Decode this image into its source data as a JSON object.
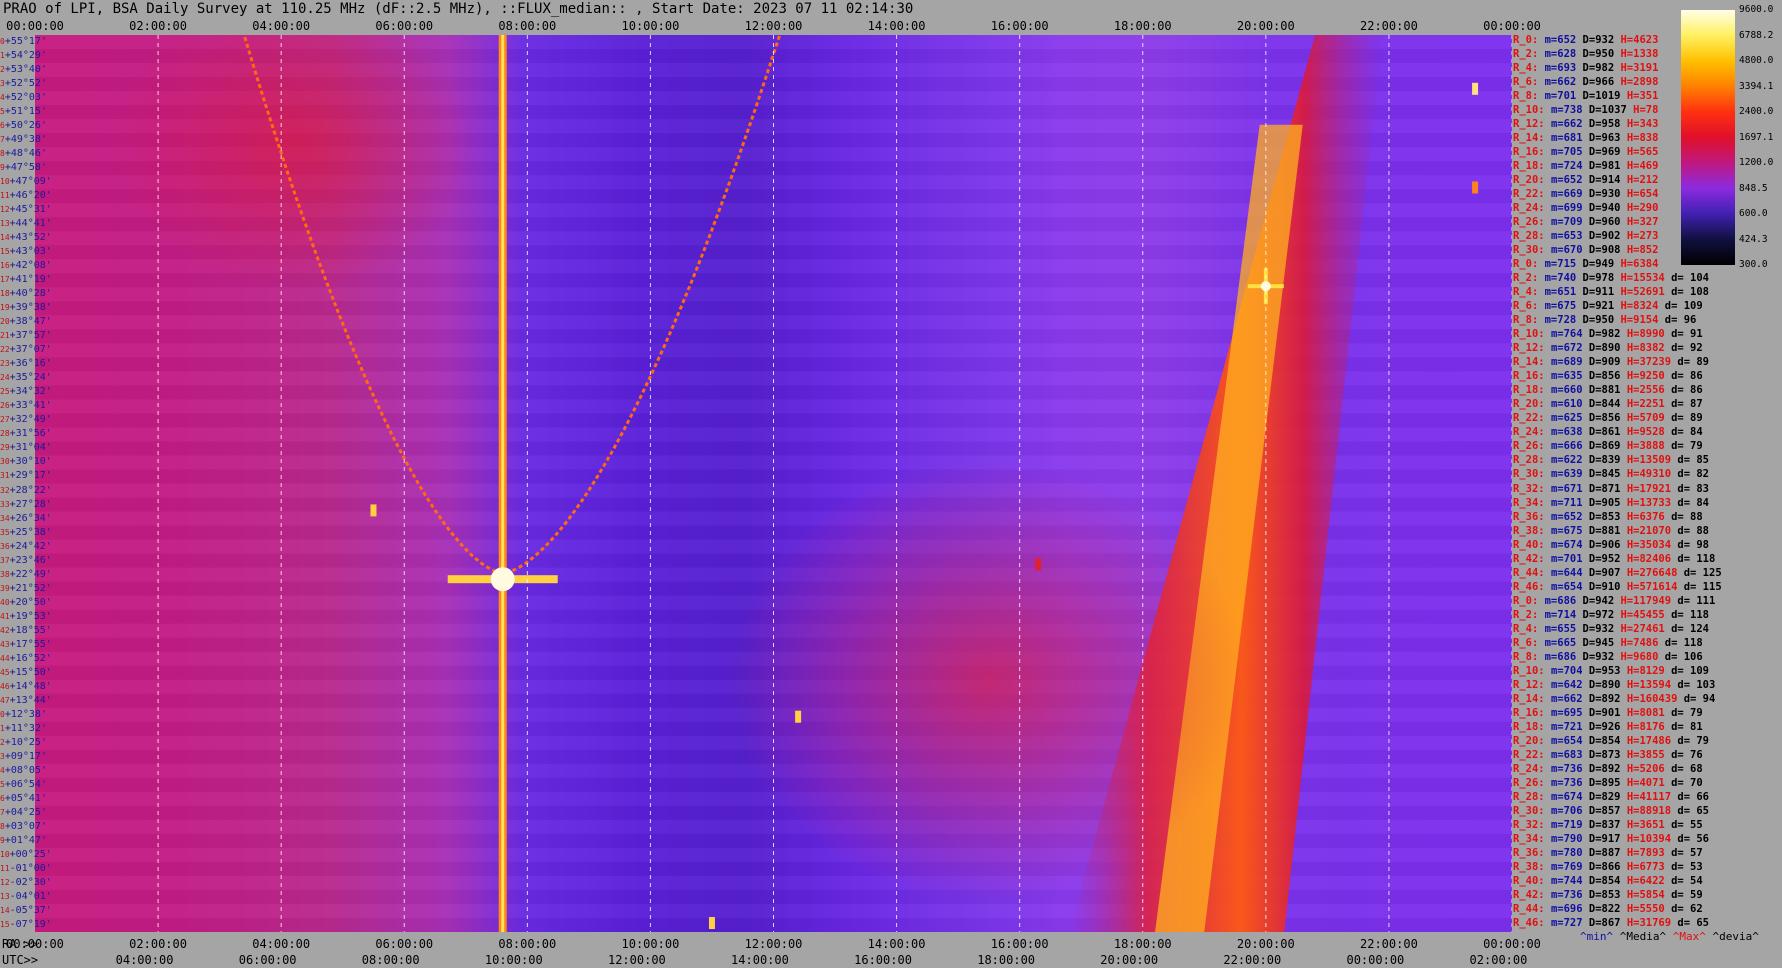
{
  "header": {
    "title": "PRAO of LPI, BSA Daily Survey at 110.25 MHz (dF::2.5 MHz), ::FLUX_median:: , Start Date: 2023 07 11 02:14:30"
  },
  "axes": {
    "top_ticks": [
      "00:00:00",
      "02:00:00",
      "04:00:00",
      "06:00:00",
      "08:00:00",
      "10:00:00",
      "12:00:00",
      "14:00:00",
      "16:00:00",
      "18:00:00",
      "20:00:00",
      "22:00:00",
      "00:00:00"
    ],
    "ra_tag": "RA >>",
    "ra_ticks": [
      "00:00:00",
      "02:00:00",
      "04:00:00",
      "06:00:00",
      "08:00:00",
      "10:00:00",
      "12:00:00",
      "14:00:00",
      "16:00:00",
      "18:00:00",
      "20:00:00",
      "22:00:00",
      "00:00:00"
    ],
    "utc_tag": "UTC>>",
    "utc_ticks": [
      "04:00:00",
      "06:00:00",
      "08:00:00",
      "10:00:00",
      "12:00:00",
      "14:00:00",
      "16:00:00",
      "18:00:00",
      "20:00:00",
      "22:00:00",
      "00:00:00",
      "02:00:00"
    ],
    "declinations": [
      "+55°17'",
      "+54°29'",
      "+53°40'",
      "+52°52'",
      "+52°03'",
      "+51°15'",
      "+50°26'",
      "+49°38'",
      "+48°46'",
      "+47°58'",
      "+47°09'",
      "+46°20'",
      "+45°31'",
      "+44°41'",
      "+43°52'",
      "+43°03'",
      "+42°08'",
      "+41°19'",
      "+40°28'",
      "+39°38'",
      "+38°47'",
      "+37°57'",
      "+37°07'",
      "+36°16'",
      "+35°24'",
      "+34°32'",
      "+33°41'",
      "+32°49'",
      "+31°56'",
      "+31°04'",
      "+30°10'",
      "+29°17'",
      "+28°22'",
      "+27°28'",
      "+26°34'",
      "+25°38'",
      "+24°42'",
      "+23°46'",
      "+22°49'",
      "+21°52'",
      "+20°50'",
      "+19°53'",
      "+18°55'",
      "+17°55'",
      "+16°52'",
      "+15°50'",
      "+14°48'",
      "+13°44'",
      "+12°38'",
      "+11°32'",
      "+10°25'",
      "+09°17'",
      "+08°05'",
      "+06°54'",
      "+05°41'",
      "+04°25'",
      "+03°07'",
      "+01°47'",
      "+00°25'",
      "-01°00'",
      "-02°30'",
      "-04°01'",
      "-05°37'",
      "-07°19'"
    ]
  },
  "colorbar": {
    "labels": [
      "9600.0",
      "6788.2",
      "4800.0",
      "3394.1",
      "2400.0",
      "1697.1",
      "1200.0",
      "848.5",
      "600.0",
      "424.3",
      "300.0"
    ],
    "colors": [
      "#ffffe8",
      "#fff060",
      "#ffc000",
      "#ff8000",
      "#ff3010",
      "#e0102a",
      "#c01880",
      "#8a2be0",
      "#4020b0",
      "#101040",
      "#000000"
    ]
  },
  "ray_stats": [
    {
      "r": "R_0:",
      "m": "m=652",
      "D": "D=932",
      "H": "H=4623",
      "d": ""
    },
    {
      "r": "R_2:",
      "m": "m=628",
      "D": "D=950",
      "H": "H=1338",
      "d": ""
    },
    {
      "r": "R_4:",
      "m": "m=693",
      "D": "D=982",
      "H": "H=3191",
      "d": ""
    },
    {
      "r": "R_6:",
      "m": "m=662",
      "D": "D=966",
      "H": "H=2898",
      "d": ""
    },
    {
      "r": "R_8:",
      "m": "m=701",
      "D": "D=1019",
      "H": "H=351",
      "d": ""
    },
    {
      "r": "R_10:",
      "m": "m=738",
      "D": "D=1037",
      "H": "H=78",
      "d": ""
    },
    {
      "r": "R_12:",
      "m": "m=662",
      "D": "D=958",
      "H": "H=343",
      "d": ""
    },
    {
      "r": "R_14:",
      "m": "m=681",
      "D": "D=963",
      "H": "H=838",
      "d": ""
    },
    {
      "r": "R_16:",
      "m": "m=705",
      "D": "D=969",
      "H": "H=565",
      "d": ""
    },
    {
      "r": "R_18:",
      "m": "m=724",
      "D": "D=981",
      "H": "H=469",
      "d": ""
    },
    {
      "r": "R_20:",
      "m": "m=652",
      "D": "D=914",
      "H": "H=212",
      "d": ""
    },
    {
      "r": "R_22:",
      "m": "m=669",
      "D": "D=930",
      "H": "H=654",
      "d": ""
    },
    {
      "r": "R_24:",
      "m": "m=699",
      "D": "D=940",
      "H": "H=290",
      "d": ""
    },
    {
      "r": "R_26:",
      "m": "m=709",
      "D": "D=960",
      "H": "H=327",
      "d": ""
    },
    {
      "r": "R_28:",
      "m": "m=653",
      "D": "D=902",
      "H": "H=273",
      "d": ""
    },
    {
      "r": "R_30:",
      "m": "m=670",
      "D": "D=908",
      "H": "H=852",
      "d": ""
    },
    {
      "r": "R_0:",
      "m": "m=715",
      "D": "D=949",
      "H": "H=6384",
      "d": ""
    },
    {
      "r": "R_2:",
      "m": "m=740",
      "D": "D=978",
      "H": "H=15534",
      "d": "d= 104"
    },
    {
      "r": "R_4:",
      "m": "m=651",
      "D": "D=911",
      "H": "H=52691",
      "d": "d= 108"
    },
    {
      "r": "R_6:",
      "m": "m=675",
      "D": "D=921",
      "H": "H=8324",
      "d": "d= 109"
    },
    {
      "r": "R_8:",
      "m": "m=728",
      "D": "D=950",
      "H": "H=9154",
      "d": "d= 96"
    },
    {
      "r": "R_10:",
      "m": "m=764",
      "D": "D=982",
      "H": "H=8990",
      "d": "d= 91"
    },
    {
      "r": "R_12:",
      "m": "m=672",
      "D": "D=890",
      "H": "H=8382",
      "d": "d= 92"
    },
    {
      "r": "R_14:",
      "m": "m=689",
      "D": "D=909",
      "H": "H=37239",
      "d": "d= 89"
    },
    {
      "r": "R_16:",
      "m": "m=635",
      "D": "D=856",
      "H": "H=9250",
      "d": "d= 86"
    },
    {
      "r": "R_18:",
      "m": "m=660",
      "D": "D=881",
      "H": "H=2556",
      "d": "d= 86"
    },
    {
      "r": "R_20:",
      "m": "m=610",
      "D": "D=844",
      "H": "H=2251",
      "d": "d= 87"
    },
    {
      "r": "R_22:",
      "m": "m=625",
      "D": "D=856",
      "H": "H=5709",
      "d": "d= 89"
    },
    {
      "r": "R_24:",
      "m": "m=638",
      "D": "D=861",
      "H": "H=9528",
      "d": "d= 84"
    },
    {
      "r": "R_26:",
      "m": "m=666",
      "D": "D=869",
      "H": "H=3888",
      "d": "d= 79"
    },
    {
      "r": "R_28:",
      "m": "m=622",
      "D": "D=839",
      "H": "H=13509",
      "d": "d= 85"
    },
    {
      "r": "R_30:",
      "m": "m=639",
      "D": "D=845",
      "H": "H=49310",
      "d": "d= 82"
    },
    {
      "r": "R_32:",
      "m": "m=671",
      "D": "D=871",
      "H": "H=17921",
      "d": "d= 83"
    },
    {
      "r": "R_34:",
      "m": "m=711",
      "D": "D=905",
      "H": "H=13733",
      "d": "d= 84"
    },
    {
      "r": "R_36:",
      "m": "m=652",
      "D": "D=853",
      "H": "H=6376",
      "d": "d= 88"
    },
    {
      "r": "R_38:",
      "m": "m=675",
      "D": "D=881",
      "H": "H=21070",
      "d": "d= 88"
    },
    {
      "r": "R_40:",
      "m": "m=674",
      "D": "D=906",
      "H": "H=35034",
      "d": "d= 98"
    },
    {
      "r": "R_42:",
      "m": "m=701",
      "D": "D=952",
      "H": "H=82406",
      "d": "d= 118"
    },
    {
      "r": "R_44:",
      "m": "m=644",
      "D": "D=907",
      "H": "H=276648",
      "d": "d= 125"
    },
    {
      "r": "R_46:",
      "m": "m=654",
      "D": "D=910",
      "H": "H=571614",
      "d": "d= 115"
    },
    {
      "r": "R_0:",
      "m": "m=686",
      "D": "D=942",
      "H": "H=117949",
      "d": "d= 111"
    },
    {
      "r": "R_2:",
      "m": "m=714",
      "D": "D=972",
      "H": "H=45455",
      "d": "d= 118"
    },
    {
      "r": "R_4:",
      "m": "m=655",
      "D": "D=932",
      "H": "H=27461",
      "d": "d= 124"
    },
    {
      "r": "R_6:",
      "m": "m=665",
      "D": "D=945",
      "H": "H=7486",
      "d": "d= 118"
    },
    {
      "r": "R_8:",
      "m": "m=686",
      "D": "D=932",
      "H": "H=9680",
      "d": "d= 106"
    },
    {
      "r": "R_10:",
      "m": "m=704",
      "D": "D=953",
      "H": "H=8129",
      "d": "d= 109"
    },
    {
      "r": "R_12:",
      "m": "m=642",
      "D": "D=890",
      "H": "H=13594",
      "d": "d= 103"
    },
    {
      "r": "R_14:",
      "m": "m=662",
      "D": "D=892",
      "H": "H=160439",
      "d": "d= 94"
    },
    {
      "r": "R_16:",
      "m": "m=695",
      "D": "D=901",
      "H": "H=8081",
      "d": "d= 79"
    },
    {
      "r": "R_18:",
      "m": "m=721",
      "D": "D=926",
      "H": "H=8176",
      "d": "d= 81"
    },
    {
      "r": "R_20:",
      "m": "m=654",
      "D": "D=854",
      "H": "H=17486",
      "d": "d= 79"
    },
    {
      "r": "R_22:",
      "m": "m=683",
      "D": "D=873",
      "H": "H=3855",
      "d": "d= 76"
    },
    {
      "r": "R_24:",
      "m": "m=736",
      "D": "D=892",
      "H": "H=5206",
      "d": "d= 68"
    },
    {
      "r": "R_26:",
      "m": "m=736",
      "D": "D=895",
      "H": "H=4071",
      "d": "d= 70"
    },
    {
      "r": "R_28:",
      "m": "m=674",
      "D": "D=829",
      "H": "H=41117",
      "d": "d= 66"
    },
    {
      "r": "R_30:",
      "m": "m=706",
      "D": "D=857",
      "H": "H=88918",
      "d": "d= 65"
    },
    {
      "r": "R_32:",
      "m": "m=719",
      "D": "D=837",
      "H": "H=3651",
      "d": "d= 55"
    },
    {
      "r": "R_34:",
      "m": "m=790",
      "D": "D=917",
      "H": "H=10394",
      "d": "d= 56"
    },
    {
      "r": "R_36:",
      "m": "m=780",
      "D": "D=887",
      "H": "H=7893",
      "d": "d= 57"
    },
    {
      "r": "R_38:",
      "m": "m=769",
      "D": "D=866",
      "H": "H=6773",
      "d": "d= 53"
    },
    {
      "r": "R_40:",
      "m": "m=744",
      "D": "D=854",
      "H": "H=6422",
      "d": "d= 54"
    },
    {
      "r": "R_42:",
      "m": "m=736",
      "D": "D=853",
      "H": "H=5854",
      "d": "d= 59"
    },
    {
      "r": "R_44:",
      "m": "m=696",
      "D": "D=822",
      "H": "H=5550",
      "d": "d= 62"
    },
    {
      "r": "R_46:",
      "m": "m=727",
      "D": "D=867",
      "H": "H=31769",
      "d": "d= 65"
    }
  ],
  "legend_footer": {
    "min": "^min^",
    "median": "^Media^",
    "max": "^Max^",
    "devia": "^devia^"
  },
  "chart_data": {
    "type": "heatmap",
    "title": "PRAO of LPI, BSA Daily Survey at 110.25 MHz (dF::2.5 MHz), ::FLUX_median:: , Start Date: 2023 07 11 02:14:30",
    "x_axis": "RA 00:00:00 – 24:00:00 (grid every 2 h); UTC 02:14:30 start",
    "y_axis": "Declination +55°17' to -07°19'",
    "color_scale": {
      "min": 300.0,
      "max": 9600.0,
      "scale": "log"
    },
    "grid": true,
    "features": [
      {
        "name": "vertical bright strip",
        "ra_hours": 7.6,
        "peak_dec": "+22°"
      },
      {
        "name": "bright source",
        "ra_hours": 20.0,
        "dec": "+41°"
      },
      {
        "name": "galactic plane band",
        "ra_hours_range": [
          17.5,
          21.5
        ]
      }
    ]
  }
}
